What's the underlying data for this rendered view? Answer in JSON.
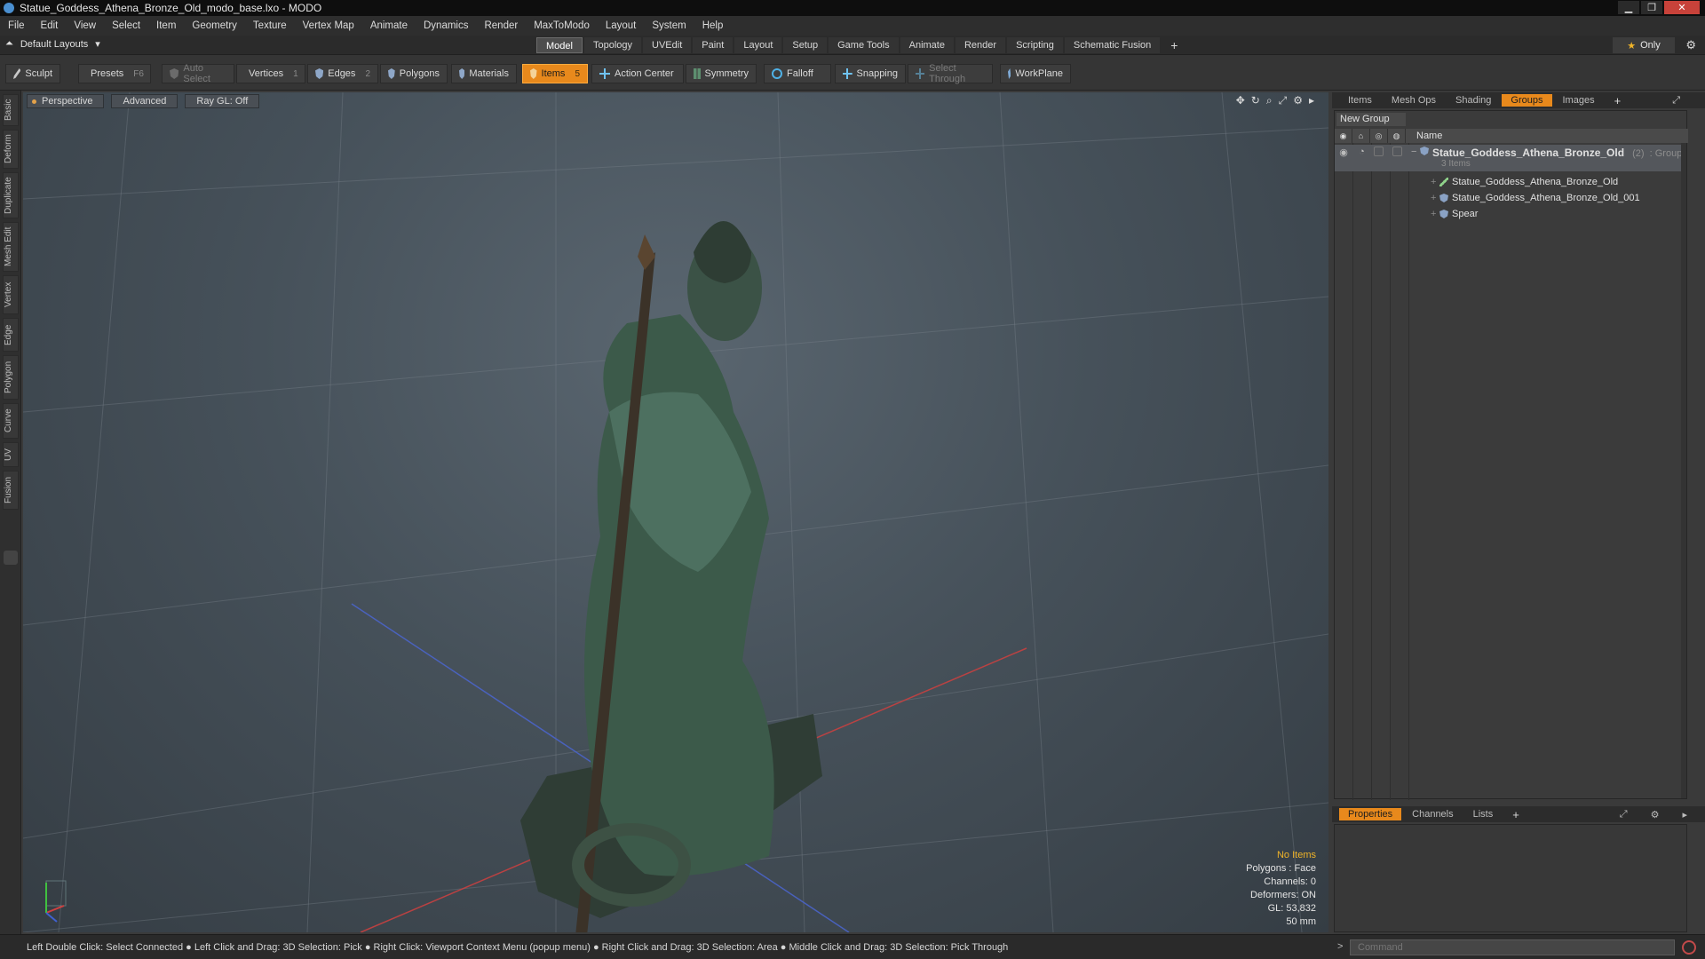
{
  "title_bar": {
    "title": "Statue_Goddess_Athena_Bronze_Old_modo_base.lxo - MODO"
  },
  "menu": [
    "File",
    "Edit",
    "View",
    "Select",
    "Item",
    "Geometry",
    "Texture",
    "Vertex Map",
    "Animate",
    "Dynamics",
    "Render",
    "MaxToModo",
    "Layout",
    "System",
    "Help"
  ],
  "layout_bar": {
    "default_layouts": "Default Layouts",
    "tabs": [
      "Model",
      "Topology",
      "UVEdit",
      "Paint",
      "Layout",
      "Setup",
      "Game Tools",
      "Animate",
      "Render",
      "Scripting",
      "Schematic Fusion"
    ],
    "active_tab": "Model",
    "only_label": "Only"
  },
  "toolbar": {
    "sculpt": "Sculpt",
    "presets": "Presets",
    "presets_key": "F6",
    "auto_select": "Auto Select",
    "vertices": "Vertices",
    "vertices_key": "1",
    "edges": "Edges",
    "edges_key": "2",
    "polygons": "Polygons",
    "materials": "Materials",
    "items": "Items",
    "items_key": "5",
    "action_center": "Action Center",
    "symmetry": "Symmetry",
    "falloff": "Falloff",
    "snapping": "Snapping",
    "select_through": "Select Through",
    "workplane": "WorkPlane"
  },
  "left_tabs": [
    "Basic",
    "Deform",
    "Duplicate",
    "Mesh Edit",
    "Vertex",
    "Edge",
    "Polygon",
    "Curve",
    "UV",
    "Fusion"
  ],
  "viewport": {
    "view_mode": "Perspective",
    "shading": "Advanced",
    "raygl": "Ray GL: Off",
    "info": {
      "selection": "No Items",
      "polygons": "Polygons : Face",
      "channels": "Channels: 0",
      "deformers": "Deformers: ON",
      "gl": "GL: 53,832",
      "focal": "50 mm"
    }
  },
  "right_panel": {
    "tabs": [
      "Items",
      "Mesh Ops",
      "Shading",
      "Groups",
      "Images"
    ],
    "active_tab": "Groups",
    "new_group": "New Group",
    "column_name": "Name",
    "group": {
      "name": "Statue_Goddess_Athena_Bronze_Old",
      "count": "(2)",
      "type": ": Group",
      "items_count": "3 Items",
      "children": [
        "Statue_Goddess_Athena_Bronze_Old",
        "Statue_Goddess_Athena_Bronze_Old_001",
        "Spear"
      ]
    }
  },
  "properties_panel": {
    "tabs": [
      "Properties",
      "Channels",
      "Lists"
    ],
    "active_tab": "Properties"
  },
  "status_bar": {
    "hint": "Left Double Click: Select Connected ● Left Click and Drag: 3D Selection: Pick ● Right Click: Viewport Context Menu (popup menu) ● Right Click and Drag: 3D Selection: Area ● Middle Click and Drag: 3D Selection: Pick Through",
    "command_placeholder": "Command"
  }
}
